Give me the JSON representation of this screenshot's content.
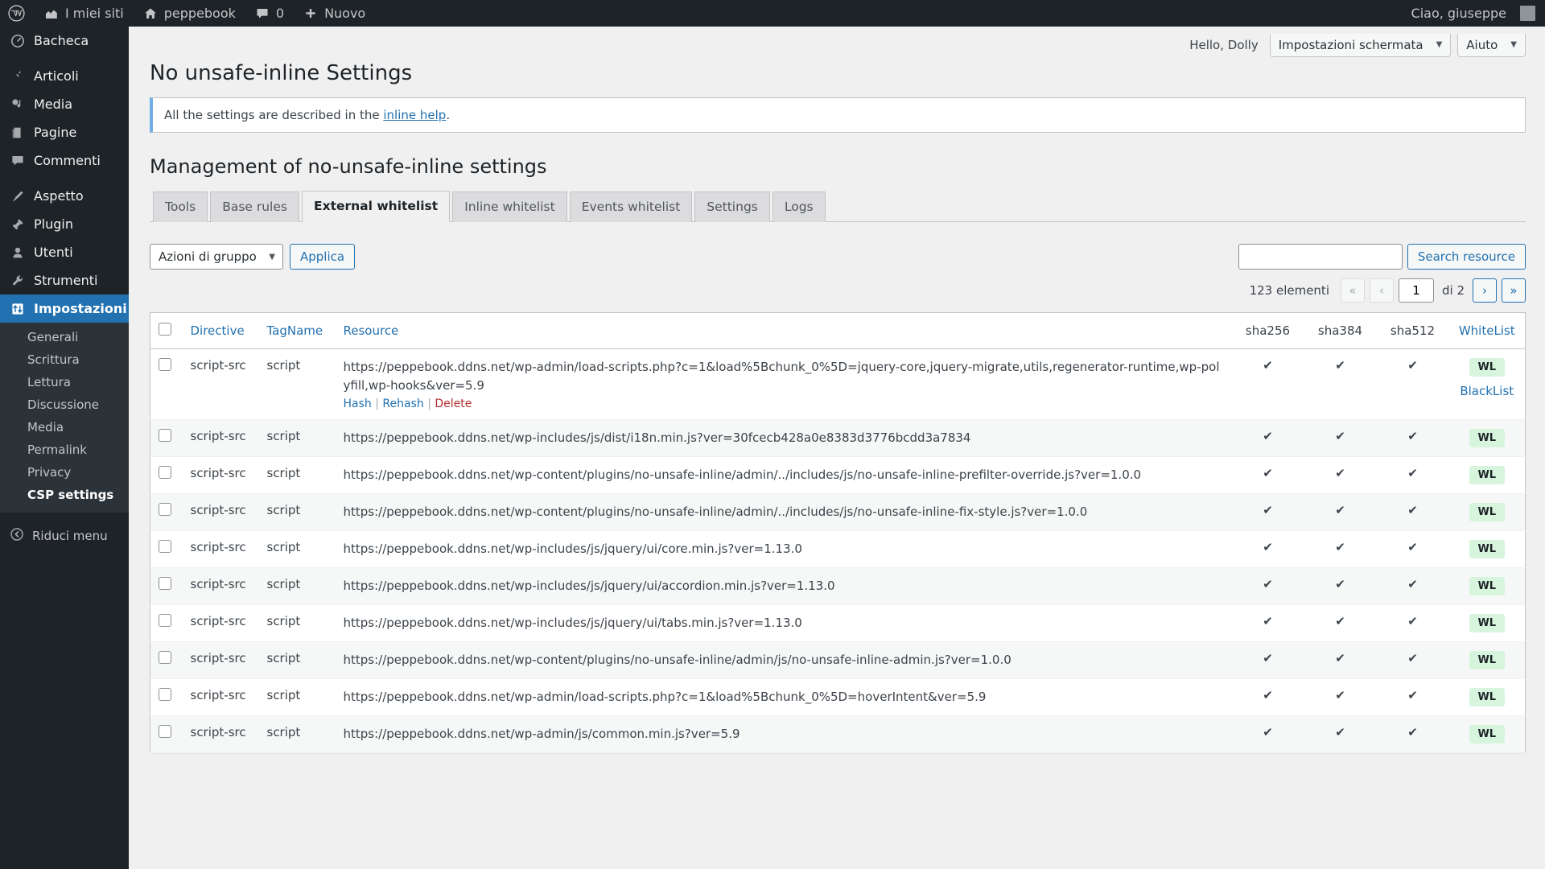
{
  "adminbar": {
    "logo_icon": "wordpress-logo-icon",
    "items": [
      {
        "icon": "sites-icon",
        "label": "I miei siti"
      },
      {
        "icon": "home-icon",
        "label": "peppebook"
      },
      {
        "icon": "comment-icon",
        "label": "0"
      },
      {
        "icon": "plus-icon",
        "label": "Nuovo"
      }
    ],
    "account": "Ciao, giuseppe"
  },
  "sidebar": {
    "items": [
      {
        "icon": "dashboard-icon",
        "label": "Bacheca",
        "current": false
      },
      {
        "icon": "posts-icon",
        "label": "Articoli",
        "current": false
      },
      {
        "icon": "media-icon",
        "label": "Media",
        "current": false
      },
      {
        "icon": "pages-icon",
        "label": "Pagine",
        "current": false
      },
      {
        "icon": "comments-icon",
        "label": "Commenti",
        "current": false
      },
      {
        "icon": "appearance-icon",
        "label": "Aspetto",
        "current": false
      },
      {
        "icon": "plugins-icon",
        "label": "Plugin",
        "current": false
      },
      {
        "icon": "users-icon",
        "label": "Utenti",
        "current": false
      },
      {
        "icon": "tools-icon",
        "label": "Strumenti",
        "current": false
      },
      {
        "icon": "settings-icon",
        "label": "Impostazioni",
        "current": true
      }
    ],
    "submenu": [
      {
        "label": "Generali",
        "current": false
      },
      {
        "label": "Scrittura",
        "current": false
      },
      {
        "label": "Lettura",
        "current": false
      },
      {
        "label": "Discussione",
        "current": false
      },
      {
        "label": "Media",
        "current": false
      },
      {
        "label": "Permalink",
        "current": false
      },
      {
        "label": "Privacy",
        "current": false
      },
      {
        "label": "CSP settings",
        "current": true
      }
    ],
    "collapse_label": "Riduci menu",
    "collapse_icon": "collapse-arrow-icon"
  },
  "screen_meta": {
    "howdy": "Hello, Dolly",
    "screen_options": "Impostazioni schermata",
    "help": "Aiuto"
  },
  "page": {
    "title": "No unsafe-inline Settings",
    "notice_text_before": "All the settings are described in the ",
    "notice_link": "inline help",
    "notice_text_after": ".",
    "section_title": "Management of no-unsafe-inline settings"
  },
  "tabs": [
    {
      "label": "Tools",
      "active": false
    },
    {
      "label": "Base rules",
      "active": false
    },
    {
      "label": "External whitelist",
      "active": true
    },
    {
      "label": "Inline whitelist",
      "active": false
    },
    {
      "label": "Events whitelist",
      "active": false
    },
    {
      "label": "Settings",
      "active": false
    },
    {
      "label": "Logs",
      "active": false
    }
  ],
  "tablenav": {
    "bulk_selected": "Azioni di gruppo",
    "bulk_options": [
      "Azioni di gruppo"
    ],
    "apply_label": "Applica",
    "search_value": "",
    "search_placeholder": "",
    "search_button": "Search resource",
    "displaying_num": "123 elementi",
    "first_page_icon": "«",
    "prev_page_icon": "‹",
    "current_page": "1",
    "of_label": "di 2",
    "next_page_icon": "›",
    "last_page_icon": "»"
  },
  "table": {
    "columns": {
      "directive": "Directive",
      "tagname": "TagName",
      "resource": "Resource",
      "sha256": "sha256",
      "sha384": "sha384",
      "sha512": "sha512",
      "whitelist": "WhiteList"
    },
    "check_mark": "✔",
    "wl_badge": "WL",
    "row_actions": {
      "hash": "Hash",
      "rehash": "Rehash",
      "delete": "Delete",
      "blacklist": "BlackList",
      "separator": "|"
    },
    "rows": [
      {
        "directive": "script-src",
        "tagname": "script",
        "resource": "https://peppebook.ddns.net/wp-admin/load-scripts.php?c=1&load%5Bchunk_0%5D=jquery-core,jquery-migrate,utils,regenerator-runtime,wp-polyfill,wp-hooks&ver=5.9",
        "sha256": true,
        "sha384": true,
        "sha512": true,
        "whitelist": "WL",
        "has_actions": true,
        "has_blacklist": true
      },
      {
        "directive": "script-src",
        "tagname": "script",
        "resource": "https://peppebook.ddns.net/wp-includes/js/dist/i18n.min.js?ver=30fcecb428a0e8383d3776bcdd3a7834",
        "sha256": true,
        "sha384": true,
        "sha512": true,
        "whitelist": "WL",
        "has_actions": false,
        "has_blacklist": false
      },
      {
        "directive": "script-src",
        "tagname": "script",
        "resource": "https://peppebook.ddns.net/wp-content/plugins/no-unsafe-inline/admin/../includes/js/no-unsafe-inline-prefilter-override.js?ver=1.0.0",
        "sha256": true,
        "sha384": true,
        "sha512": true,
        "whitelist": "WL",
        "has_actions": false,
        "has_blacklist": false
      },
      {
        "directive": "script-src",
        "tagname": "script",
        "resource": "https://peppebook.ddns.net/wp-content/plugins/no-unsafe-inline/admin/../includes/js/no-unsafe-inline-fix-style.js?ver=1.0.0",
        "sha256": true,
        "sha384": true,
        "sha512": true,
        "whitelist": "WL",
        "has_actions": false,
        "has_blacklist": false
      },
      {
        "directive": "script-src",
        "tagname": "script",
        "resource": "https://peppebook.ddns.net/wp-includes/js/jquery/ui/core.min.js?ver=1.13.0",
        "sha256": true,
        "sha384": true,
        "sha512": true,
        "whitelist": "WL",
        "has_actions": false,
        "has_blacklist": false
      },
      {
        "directive": "script-src",
        "tagname": "script",
        "resource": "https://peppebook.ddns.net/wp-includes/js/jquery/ui/accordion.min.js?ver=1.13.0",
        "sha256": true,
        "sha384": true,
        "sha512": true,
        "whitelist": "WL",
        "has_actions": false,
        "has_blacklist": false
      },
      {
        "directive": "script-src",
        "tagname": "script",
        "resource": "https://peppebook.ddns.net/wp-includes/js/jquery/ui/tabs.min.js?ver=1.13.0",
        "sha256": true,
        "sha384": true,
        "sha512": true,
        "whitelist": "WL",
        "has_actions": false,
        "has_blacklist": false
      },
      {
        "directive": "script-src",
        "tagname": "script",
        "resource": "https://peppebook.ddns.net/wp-content/plugins/no-unsafe-inline/admin/js/no-unsafe-inline-admin.js?ver=1.0.0",
        "sha256": true,
        "sha384": true,
        "sha512": true,
        "whitelist": "WL",
        "has_actions": false,
        "has_blacklist": false
      },
      {
        "directive": "script-src",
        "tagname": "script",
        "resource": "https://peppebook.ddns.net/wp-admin/load-scripts.php?c=1&load%5Bchunk_0%5D=hoverIntent&ver=5.9",
        "sha256": true,
        "sha384": true,
        "sha512": true,
        "whitelist": "WL",
        "has_actions": false,
        "has_blacklist": false
      },
      {
        "directive": "script-src",
        "tagname": "script",
        "resource": "https://peppebook.ddns.net/wp-admin/js/common.min.js?ver=5.9",
        "sha256": true,
        "sha384": true,
        "sha512": true,
        "whitelist": "WL",
        "has_actions": false,
        "has_blacklist": false
      }
    ]
  },
  "colors": {
    "admin_dark": "#1d2327",
    "accent_blue": "#2271b1",
    "wl_green_bg": "#d7f5dd",
    "delete_red": "#b32d2e"
  }
}
